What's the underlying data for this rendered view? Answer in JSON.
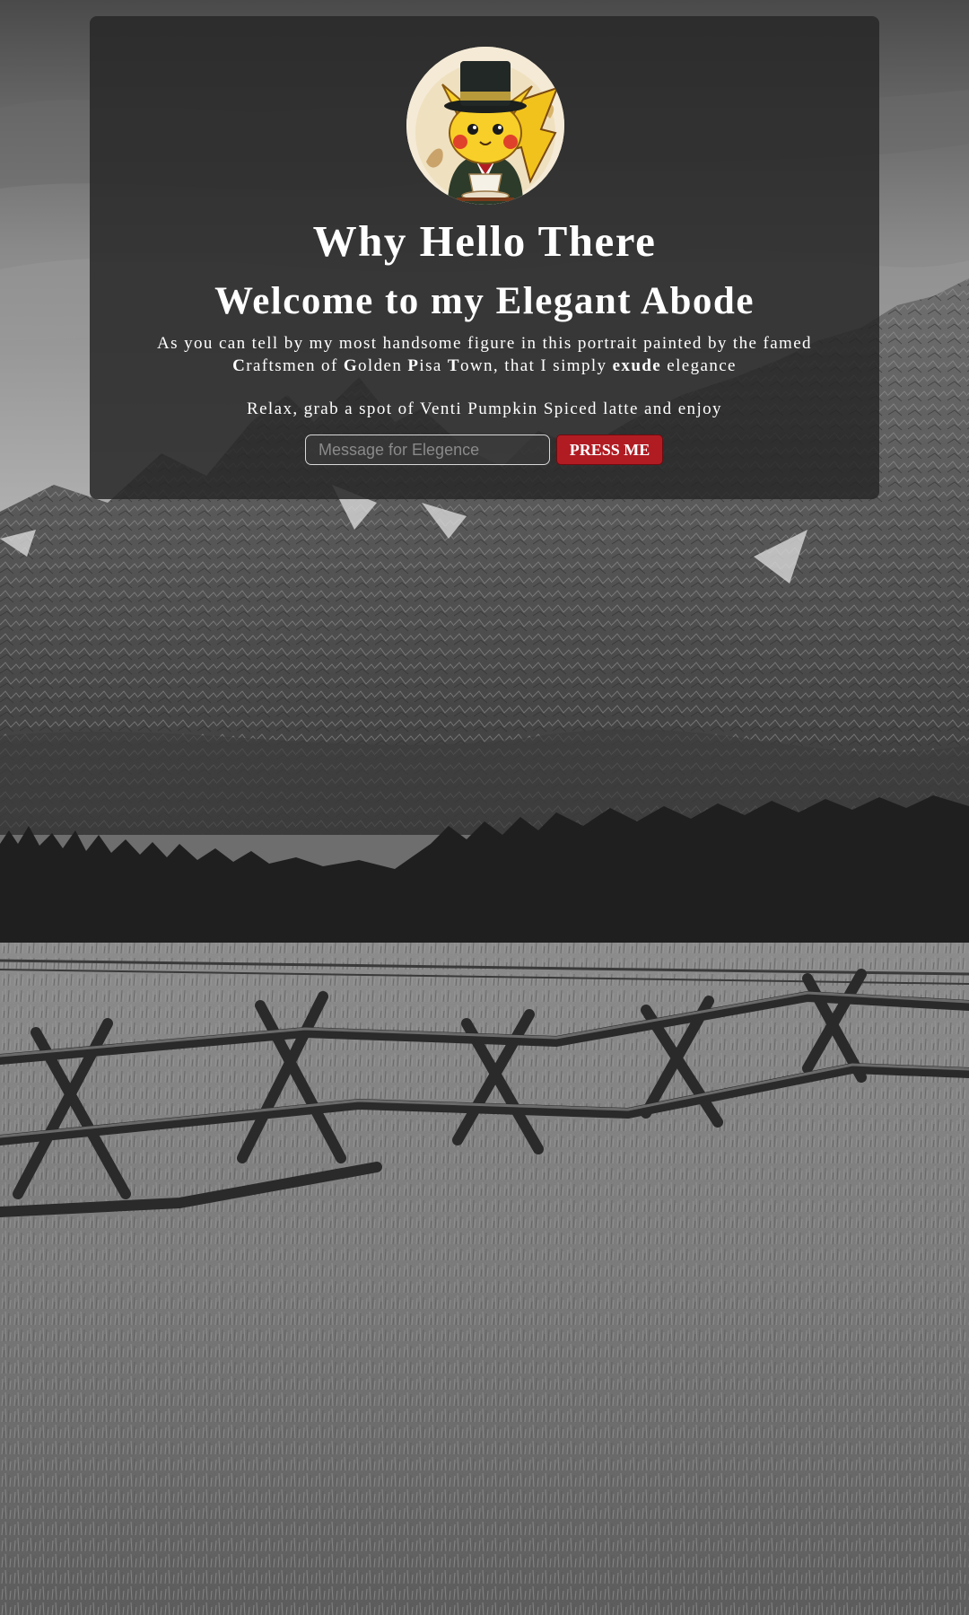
{
  "hero": {
    "title": "Why Hello There",
    "subtitle": "Welcome to my Elegant Abode",
    "intro_parts": [
      "As you can tell by my most handsome figure in this portrait painted by the famed ",
      "C",
      "raftsmen of ",
      "G",
      "olden ",
      "P",
      "isa ",
      "T",
      "own, that I simply ",
      "exude",
      " elegance"
    ],
    "relax": "Relax, grab a spot of Venti Pumpkin Spiced latte and enjoy"
  },
  "form": {
    "placeholder": "Message for Elegence",
    "button_label": "PRESS ME"
  },
  "colors": {
    "card_bg": "#282828",
    "button_bg": "#b11c23",
    "text": "#ffffff"
  },
  "icons": {
    "avatar": "pikachu-top-hat-portrait"
  }
}
